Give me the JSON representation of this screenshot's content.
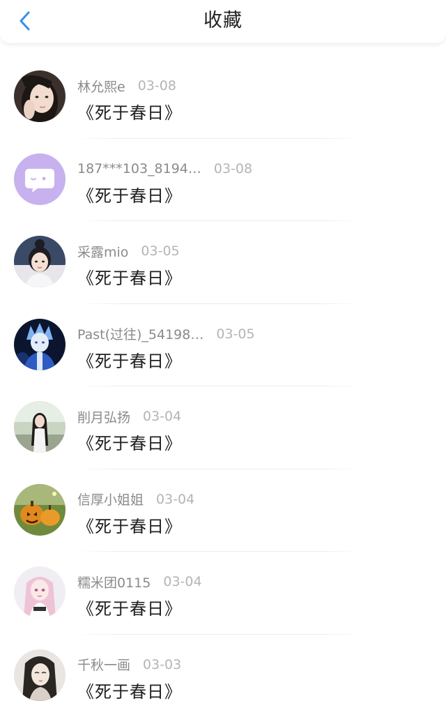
{
  "header": {
    "title": "收藏",
    "back_icon": "chevron-left-icon",
    "accent": "#3a8ee6"
  },
  "favorites": [
    {
      "name": "林允熙e",
      "date": "03-08",
      "work": "《死于春日》",
      "avatar": "photo-avatar"
    },
    {
      "name": "187***103_8194…",
      "date": "03-08",
      "work": "《死于春日》",
      "avatar": "default-chat-avatar"
    },
    {
      "name": "采露mio",
      "date": "03-05",
      "work": "《死于春日》",
      "avatar": "illustrated-avatar"
    },
    {
      "name": "Past(过往)_54198…",
      "date": "03-05",
      "work": "《死于春日》",
      "avatar": "illustrated-avatar"
    },
    {
      "name": "削月弘扬",
      "date": "03-04",
      "work": "《死于春日》",
      "avatar": "photo-avatar"
    },
    {
      "name": "信厚小姐姐",
      "date": "03-04",
      "work": "《死于春日》",
      "avatar": "pumpkin-avatar"
    },
    {
      "name": "糯米团0115",
      "date": "03-04",
      "work": "《死于春日》",
      "avatar": "illustrated-avatar"
    },
    {
      "name": "千秋一画",
      "date": "03-03",
      "work": "《死于春日》",
      "avatar": "illustrated-avatar"
    }
  ]
}
